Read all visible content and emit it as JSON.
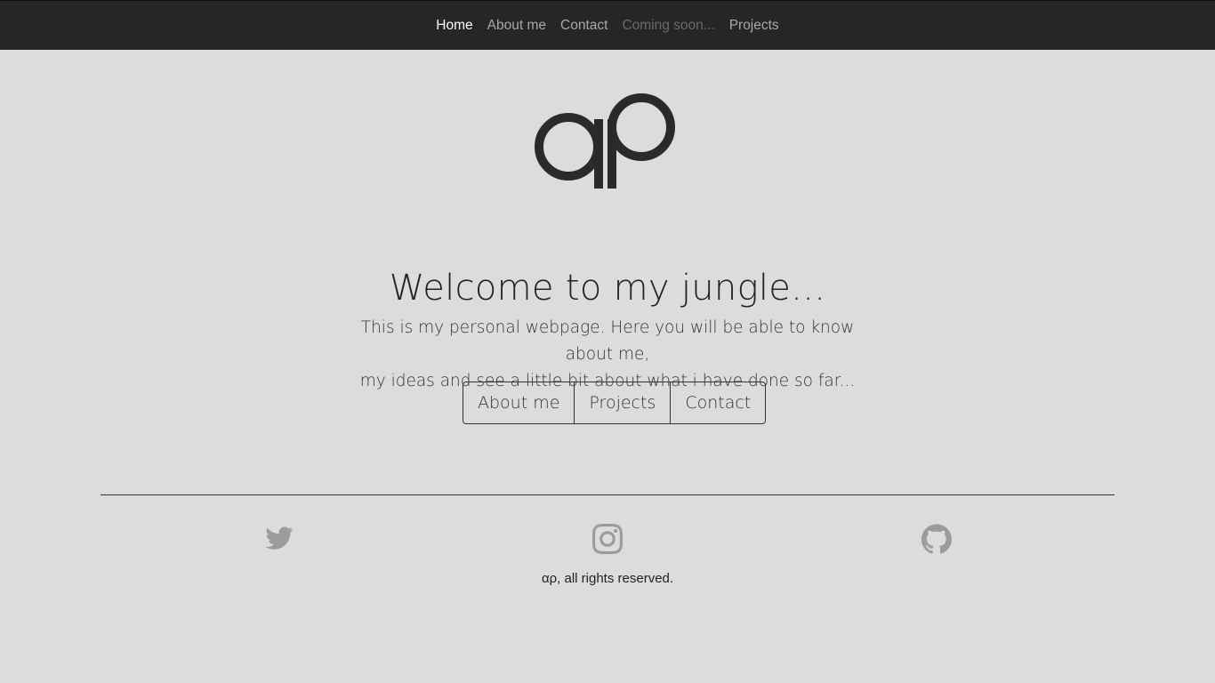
{
  "nav": {
    "items": [
      {
        "label": "Home",
        "state": "active"
      },
      {
        "label": "About me",
        "state": "normal"
      },
      {
        "label": "Contact",
        "state": "normal"
      },
      {
        "label": "Coming soon...",
        "state": "disabled"
      },
      {
        "label": "Projects",
        "state": "normal"
      }
    ]
  },
  "hero": {
    "logo_icon": "ap-monogram-logo",
    "title": "Welcome to my jungle...",
    "lead_line1": "This is my personal webpage. Here you will be able to know about me,",
    "lead_line2": "my ideas and see a little bit about what i have done so far...",
    "buttons": [
      "About me",
      "Projects",
      "Contact"
    ]
  },
  "footer": {
    "social_icons": [
      "twitter-icon",
      "instagram-icon",
      "github-icon"
    ],
    "copyright": "αρ, all rights reserved."
  },
  "colors": {
    "background": "#dcdcdc",
    "navbar": "#262626",
    "nav_active": "#ffffff",
    "nav_link": "#a8a8a8",
    "nav_disabled": "#6a6a6a",
    "social_icon": "#9b9b9b"
  }
}
